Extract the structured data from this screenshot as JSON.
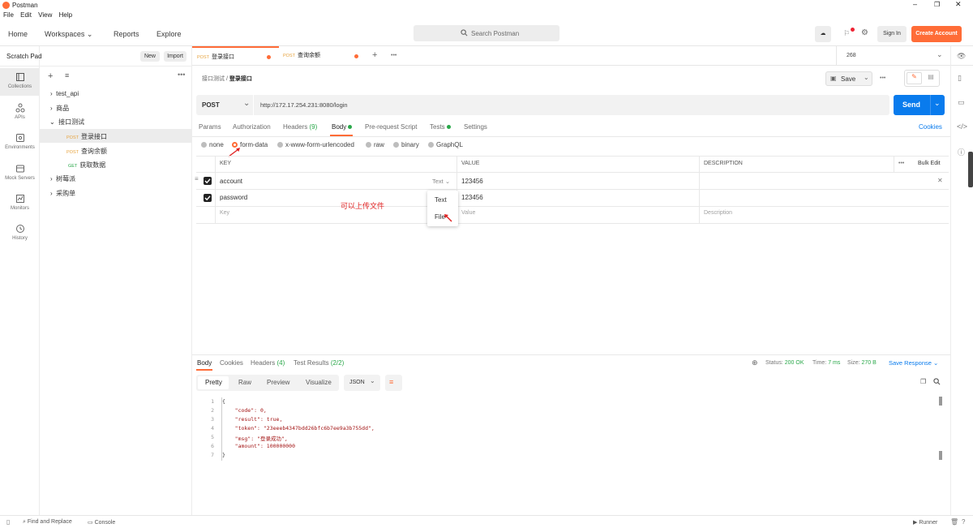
{
  "window": {
    "title": "Postman"
  },
  "menu": [
    "File",
    "Edit",
    "View",
    "Help"
  ],
  "header": {
    "nav": [
      "Home",
      "Workspaces",
      "Reports",
      "Explore"
    ],
    "search_placeholder": "Search Postman",
    "sign_in": "Sign In",
    "create_account": "Create Account"
  },
  "rail": [
    "Collections",
    "APIs",
    "Environments",
    "Mock Servers",
    "Monitors",
    "History"
  ],
  "sidebar": {
    "title": "Scratch Pad",
    "new_label": "New",
    "import_label": "Import",
    "tree": [
      {
        "label": "test_api",
        "type": "folder"
      },
      {
        "label": "商品",
        "type": "folder"
      },
      {
        "label": "接口测试",
        "type": "folder-open"
      },
      {
        "label": "登录接口",
        "method": "POST",
        "type": "request"
      },
      {
        "label": "查询余额",
        "method": "POST",
        "type": "request"
      },
      {
        "label": "获取数据",
        "method": "GET",
        "type": "request"
      },
      {
        "label": "树莓派",
        "type": "folder"
      },
      {
        "label": "采购单",
        "type": "folder"
      }
    ]
  },
  "tabs": [
    {
      "method": "POST",
      "label": "登录接口"
    },
    {
      "method": "POST",
      "label": "查询余额"
    }
  ],
  "env": {
    "value": "268"
  },
  "request": {
    "breadcrumb_parent": "接口测试",
    "breadcrumb_sep": "/",
    "breadcrumb_current": "登录接口",
    "save_label": "Save",
    "method": "POST",
    "url": "http://172.17.254.231:8080/login",
    "send_label": "Send",
    "cookies_label": "Cookies",
    "subtabs": [
      "Params",
      "Authorization",
      "Headers",
      "(9)",
      "Body",
      "Pre-request Script",
      "Tests",
      "Settings"
    ],
    "body_modes": [
      "none",
      "form-data",
      "x-www-form-urlencoded",
      "raw",
      "binary",
      "GraphQL"
    ],
    "table_headers": {
      "key": "KEY",
      "value": "VALUE",
      "description": "DESCRIPTION",
      "bulk_edit": "Bulk Edit"
    },
    "rows": [
      {
        "key": "account",
        "type": "Text",
        "value": "123456"
      },
      {
        "key": "password",
        "value": "123456"
      }
    ],
    "placeholders": {
      "key": "Key",
      "value": "Value",
      "description": "Description"
    },
    "dropdown": [
      "Text",
      "File"
    ],
    "annotation": "可以上传文件"
  },
  "response": {
    "tabs": [
      "Body",
      "Cookies",
      "Headers",
      "(4)",
      "Test Results",
      "(2/2)"
    ],
    "status_label": "Status:",
    "status": "200 OK",
    "time_label": "Time:",
    "time": "7 ms",
    "size_label": "Size:",
    "size": "270 B",
    "save_response": "Save Response",
    "views": [
      "Pretty",
      "Raw",
      "Preview",
      "Visualize"
    ],
    "format": "JSON",
    "code_lines": [
      "{",
      "    \"code\": 0,",
      "    \"result\": true,",
      "    \"token\": \"23eeeb4347bdd26bfc6b7ee9a3b755dd\",",
      "    \"msg\": \"登录成功\",",
      "    \"amount\": 100000000",
      "}"
    ],
    "line_numbers": [
      "1",
      "2",
      "3",
      "4",
      "5",
      "6",
      "7"
    ]
  },
  "statusbar": {
    "find_replace": "Find and Replace",
    "console": "Console",
    "runner": "Runner"
  },
  "colors": {
    "accent": "#ff6c37",
    "send": "#097bed",
    "annotation": "#e02020"
  }
}
